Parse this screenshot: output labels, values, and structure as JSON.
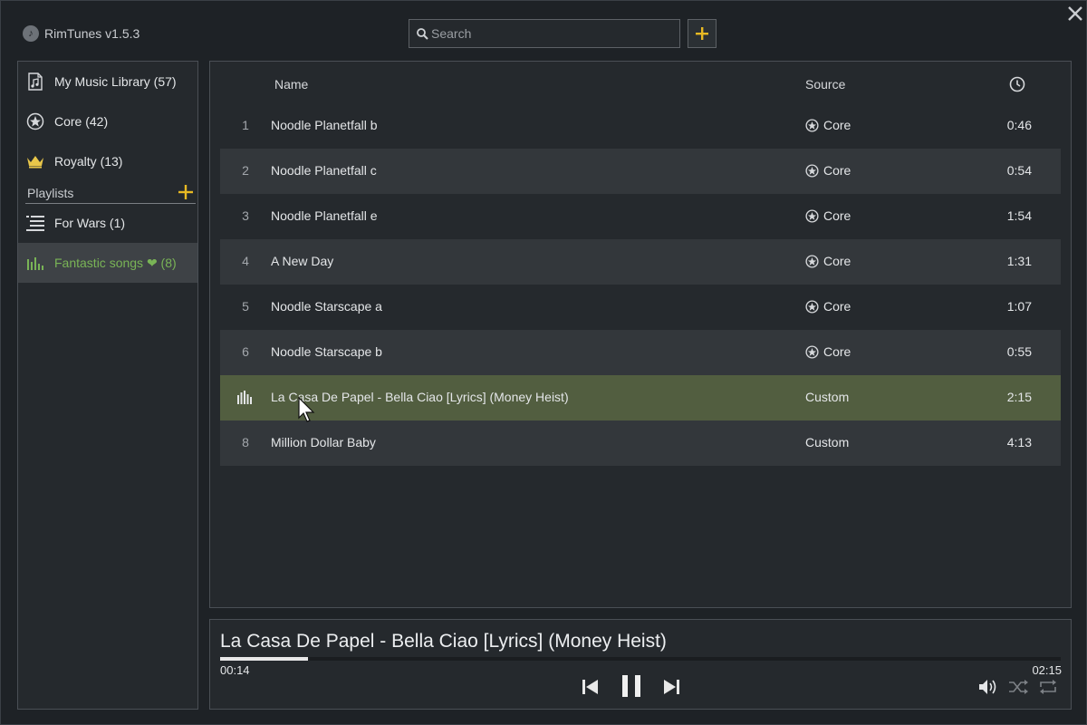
{
  "app": {
    "title": "RimTunes v1.5.3"
  },
  "search": {
    "placeholder": "Search",
    "value": ""
  },
  "sidebar": {
    "library_items": [
      {
        "label": "My Music Library (57)",
        "icon": "music-file-icon"
      },
      {
        "label": "Core (42)",
        "icon": "core-star-icon"
      },
      {
        "label": "Royalty (13)",
        "icon": "crown-icon"
      }
    ],
    "playlists_header": "Playlists",
    "playlists": [
      {
        "label": "For Wars (1)",
        "icon": "list-icon",
        "active": false
      },
      {
        "label": "Fantastic songs ❤ (8)",
        "icon": "equalizer-icon",
        "active": true
      }
    ]
  },
  "table": {
    "columns": {
      "name": "Name",
      "source": "Source",
      "duration_icon": "clock-icon"
    },
    "rows": [
      {
        "num": "1",
        "name": "Noodle Planetfall b",
        "source": "Core",
        "duration": "0:46"
      },
      {
        "num": "2",
        "name": "Noodle Planetfall c",
        "source": "Core",
        "duration": "0:54"
      },
      {
        "num": "3",
        "name": "Noodle Planetfall e",
        "source": "Core",
        "duration": "1:54"
      },
      {
        "num": "4",
        "name": "A New Day",
        "source": "Core",
        "duration": "1:31"
      },
      {
        "num": "5",
        "name": "Noodle Starscape a",
        "source": "Core",
        "duration": "1:07"
      },
      {
        "num": "6",
        "name": "Noodle Starscape b",
        "source": "Core",
        "duration": "0:55"
      },
      {
        "num": "",
        "name": "La Casa De Papel - Bella Ciao [Lyrics] (Money Heist)",
        "source": "Custom",
        "duration": "2:15",
        "playing": true
      },
      {
        "num": "8",
        "name": "Million Dollar Baby",
        "source": "Custom",
        "duration": "4:13"
      }
    ]
  },
  "player": {
    "title": "La Casa De Papel - Bella Ciao [Lyrics] (Money Heist)",
    "elapsed": "00:14",
    "total": "02:15",
    "progress_fraction": 0.104
  },
  "colors": {
    "accent": "#e8b923",
    "active_text": "#79b456",
    "playing_row": "#525e40"
  }
}
